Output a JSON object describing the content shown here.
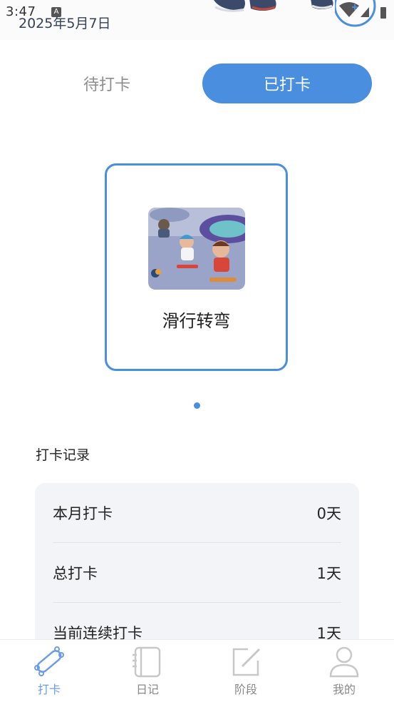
{
  "status_bar": {
    "time": "3:47",
    "indicator": "A",
    "icons": [
      "wifi-icon",
      "signal-icon",
      "battery-icon"
    ]
  },
  "header": {
    "date": "2025年5月7日"
  },
  "tabs": [
    {
      "label": "待打卡",
      "active": false
    },
    {
      "label": "已打卡",
      "active": true
    }
  ],
  "card": {
    "title": "滑行转弯",
    "image": "skateboarding-kids-illustration"
  },
  "pager": {
    "current": 1,
    "total": 1
  },
  "records": {
    "title": "打卡记录",
    "rows": [
      {
        "label": "本月打卡",
        "value": "0天"
      },
      {
        "label": "总打卡",
        "value": "1天"
      },
      {
        "label": "当前连续打卡",
        "value": "1天"
      }
    ]
  },
  "nav": [
    {
      "label": "打卡",
      "icon": "skateboard-icon",
      "active": true
    },
    {
      "label": "日记",
      "icon": "notebook-icon",
      "active": false
    },
    {
      "label": "阶段",
      "icon": "edit-icon",
      "active": false
    },
    {
      "label": "我的",
      "icon": "user-icon",
      "active": false
    }
  ],
  "colors": {
    "accent": "#4a8ee0",
    "nav_active": "#6a9de6",
    "record_bg": "#f3f4f8"
  }
}
